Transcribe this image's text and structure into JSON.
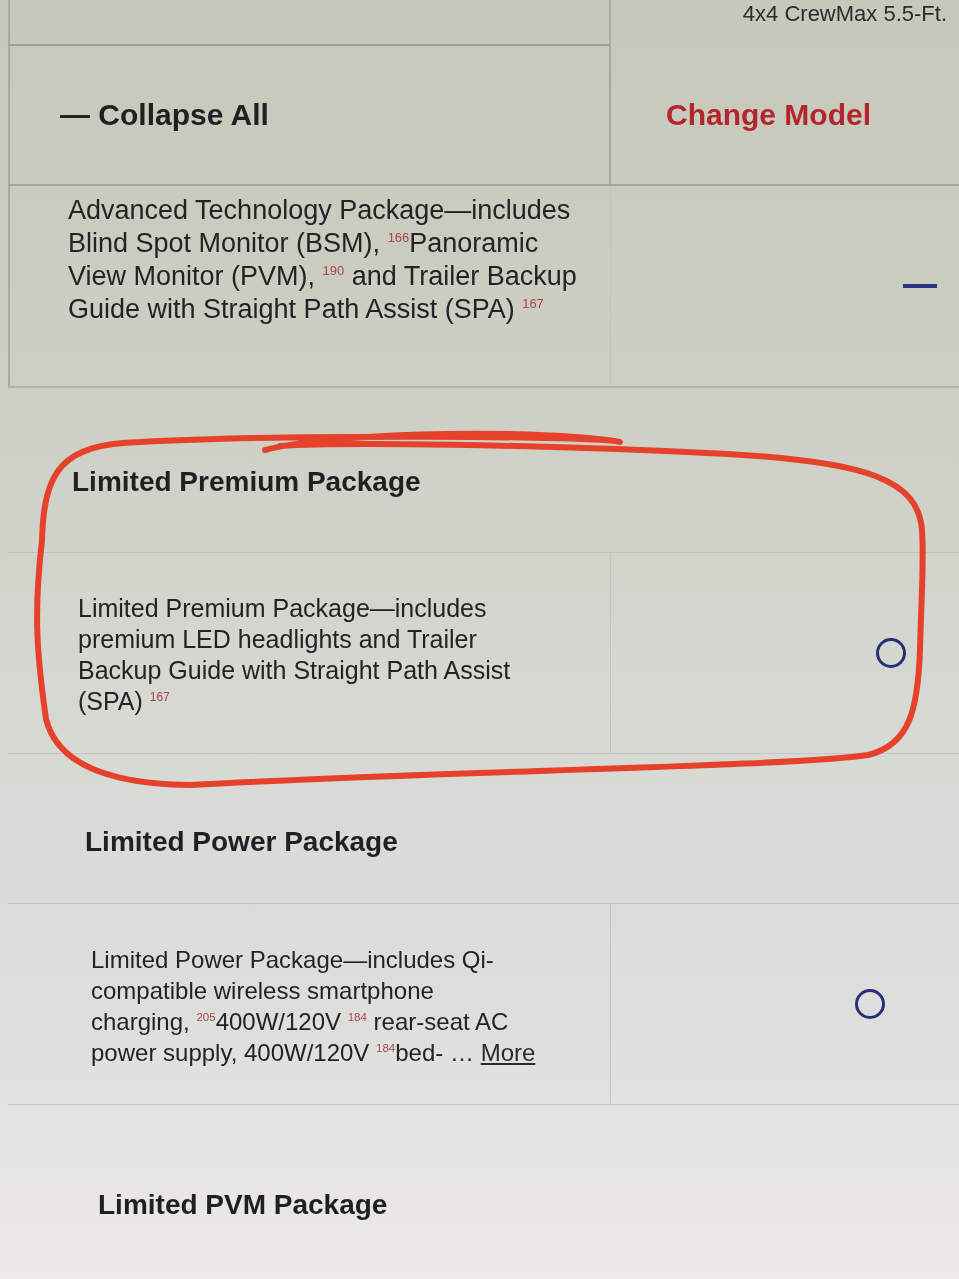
{
  "header": {
    "column_2": "4x4 CrewMax 5.5-Ft."
  },
  "actions": {
    "collapse_all": "— Collapse All",
    "change_model": "Change Model"
  },
  "packages": [
    {
      "description": "Advanced Technology Package—includes Blind Spot Monitor (BSM), $^{166}$Panoramic View Monitor (PVM), $^{190}$ and Trailer Backup Guide with Straight Path Assist (SPA) $^{167}$",
      "kind": "unavailable",
      "highlighted": false
    },
    {
      "heading": "Limited Premium Package",
      "description": "Limited Premium Package—includes premium LED headlights and Trailer Backup Guide with Straight Path Assist (SPA) $^{167}$",
      "kind": "radio",
      "selected": false,
      "highlighted": true
    },
    {
      "heading": "Limited Power Package",
      "description": "Limited Power Package—includes Qi-compatible wireless smartphone charging, $^{205}$400W/120V $^{184}$ rear-seat AC power supply, 400W/120V $^{184}$bed- …",
      "more_link": "More",
      "kind": "radio",
      "selected": false,
      "highlighted": false
    },
    {
      "heading": "Limited PVM Package",
      "highlighted": false
    }
  ]
}
